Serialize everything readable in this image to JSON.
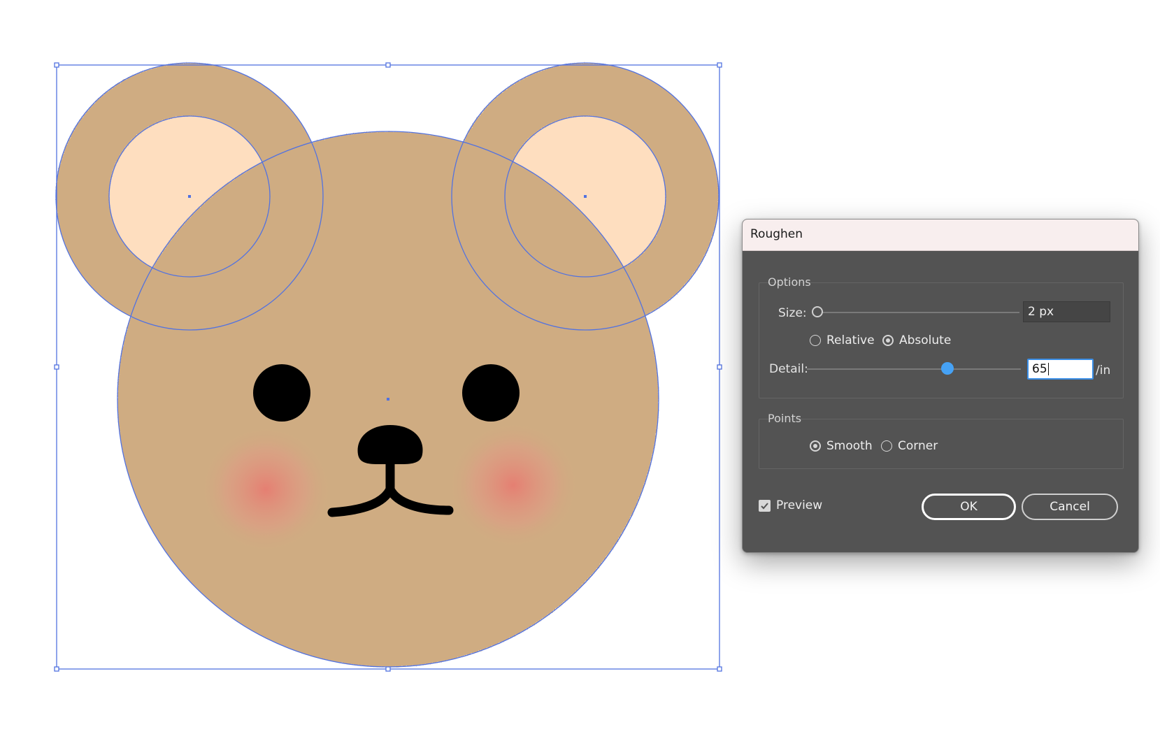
{
  "canvas": {
    "illustration": "bear-face",
    "colors": {
      "fur": "#cfac82",
      "inner_ear": "#fedebf",
      "blush": "#e57f72",
      "features": "#000000",
      "selection": "#5272e0"
    }
  },
  "dialog": {
    "title": "Roughen",
    "options": {
      "group_label": "Options",
      "size_label": "Size:",
      "size_value": "2 px",
      "size_slider_fraction": 0.0,
      "mode_options": [
        {
          "label": "Relative",
          "selected": false
        },
        {
          "label": "Absolute",
          "selected": true
        }
      ],
      "detail_label": "Detail:",
      "detail_value": "65",
      "detail_unit": "/in",
      "detail_slider_fraction": 0.65
    },
    "points": {
      "group_label": "Points",
      "options": [
        {
          "label": "Smooth",
          "selected": true
        },
        {
          "label": "Corner",
          "selected": false
        }
      ]
    },
    "preview": {
      "label": "Preview",
      "checked": true
    },
    "ok_label": "OK",
    "cancel_label": "Cancel"
  }
}
